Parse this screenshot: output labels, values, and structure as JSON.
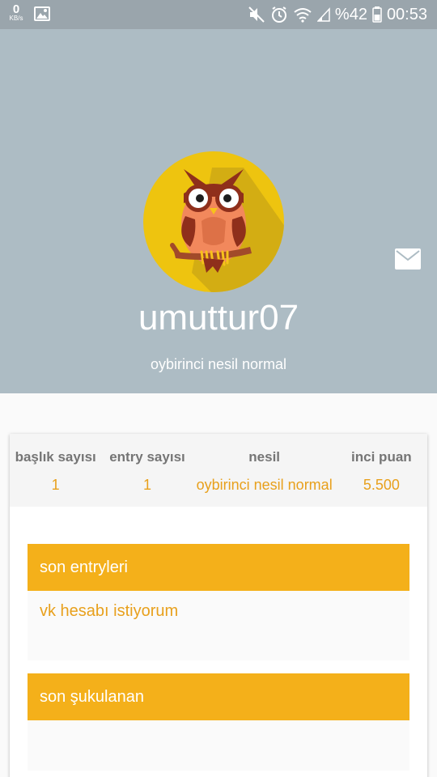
{
  "status_bar": {
    "net_speed_value": "0",
    "net_speed_unit": "KB/s",
    "battery_text": "%42",
    "time": "00:53",
    "icons": [
      "image-icon",
      "mute-icon",
      "alarm-icon",
      "wifi-icon",
      "signal-icon",
      "battery-icon"
    ]
  },
  "profile": {
    "username": "umuttur07",
    "nesil_subtitle": "oybirinci nesil normal",
    "avatar": "owl-avatar",
    "message_icon": "mail-icon"
  },
  "stats": {
    "baslik_label": "başlık sayısı",
    "baslik_value": "1",
    "entry_label": "entry sayısı",
    "entry_value": "1",
    "nesil_label": "nesil",
    "nesil_value": "oybirinci nesil normal",
    "inci_label": "inci puan",
    "inci_value": "5.500"
  },
  "sections": {
    "son_entryleri": {
      "title": "son entryleri",
      "entries": [
        "vk hesabı istiyorum"
      ]
    },
    "son_sukulanan": {
      "title": "son şukulanan"
    }
  },
  "colors": {
    "status_bar": "#9aa5ac",
    "header_bg": "#adbcc4",
    "accent": "#f4b01a",
    "link": "#e8a01c",
    "avatar_bg": "#eec40f"
  }
}
